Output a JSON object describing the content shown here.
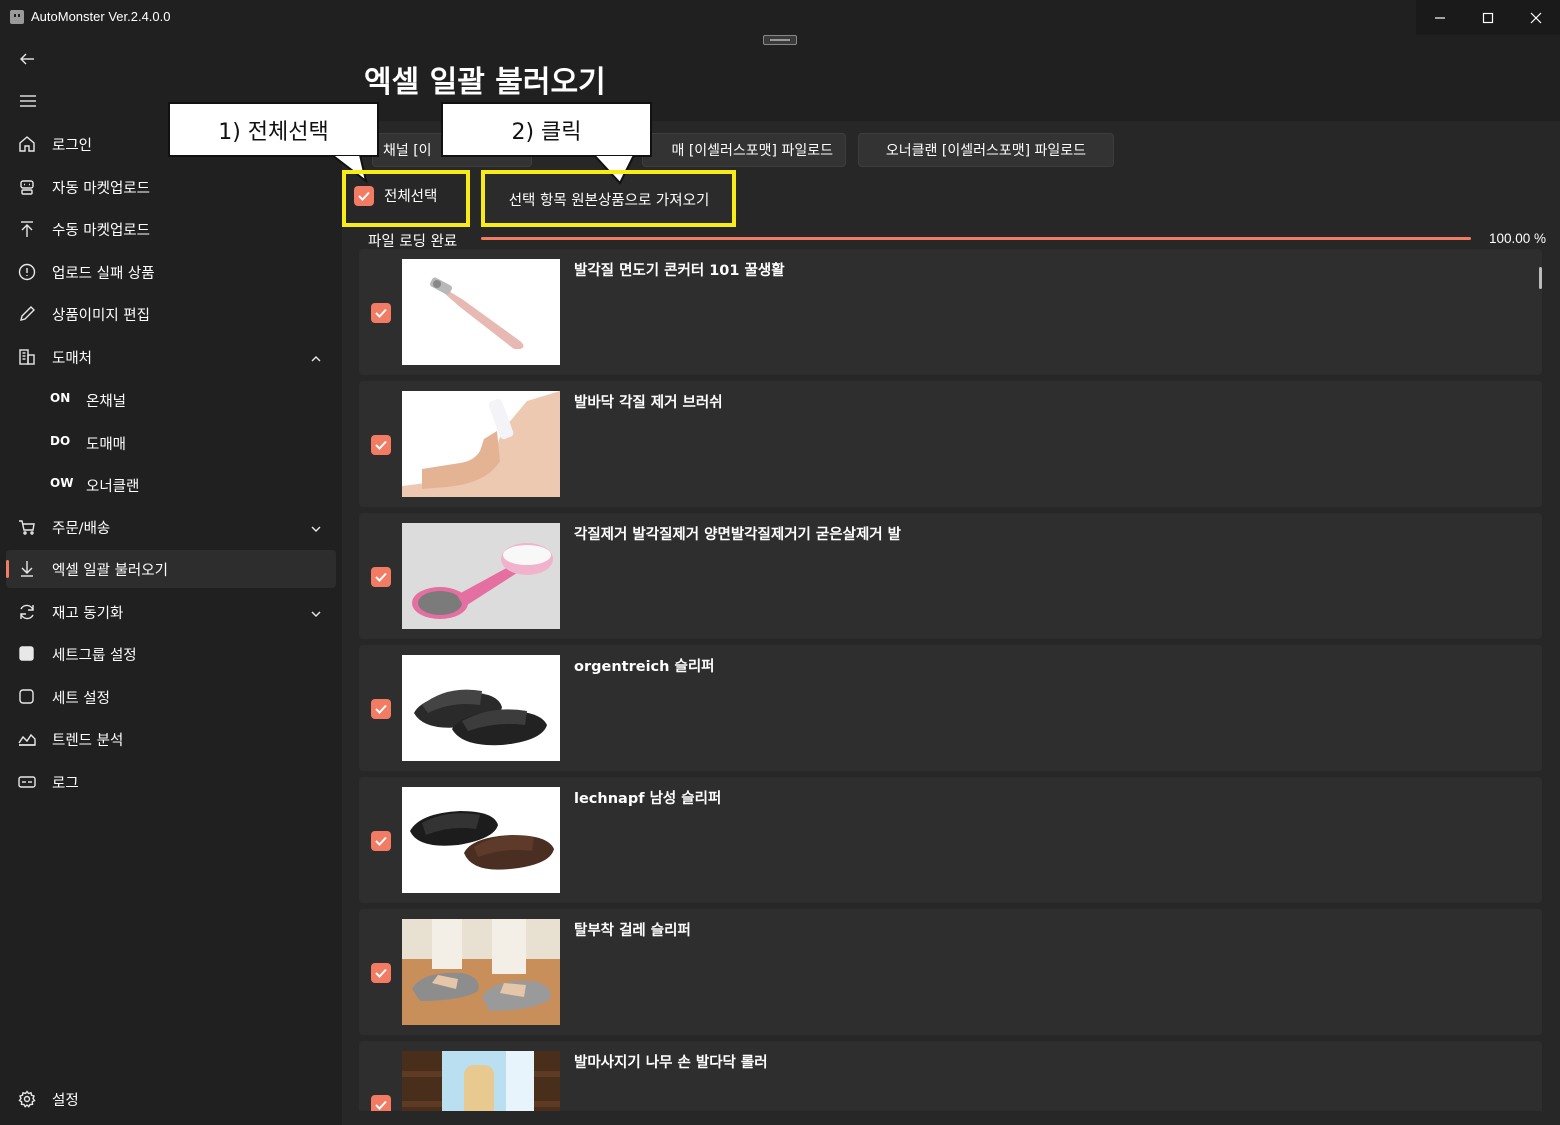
{
  "window": {
    "title": "AutoMonster Ver.2.4.0.0",
    "controls": [
      "minimize-icon",
      "maximize-icon",
      "close-icon"
    ]
  },
  "sidebar": {
    "items": [
      {
        "label": "로그인",
        "icon": "home-icon"
      },
      {
        "label": "자동 마켓업로드",
        "icon": "robot-icon"
      },
      {
        "label": "수동 마켓업로드",
        "icon": "upload-icon"
      },
      {
        "label": "업로드 실패 상품",
        "icon": "alert-circle-icon"
      },
      {
        "label": "상품이미지 편집",
        "icon": "pen-icon"
      },
      {
        "label": "도매처",
        "icon": "building-icon",
        "expanded": true
      },
      {
        "label": "주문/배송",
        "icon": "cart-icon",
        "expanded": false
      },
      {
        "label": "엑셀 일괄 불러오기",
        "icon": "download-icon",
        "active": true
      },
      {
        "label": "재고 동기화",
        "icon": "sync-icon",
        "expanded": false
      },
      {
        "label": "세트그룹 설정",
        "icon": "square-filled-icon"
      },
      {
        "label": "세트 설정",
        "icon": "square-outline-icon"
      },
      {
        "label": "트렌드 분석",
        "icon": "area-chart-icon"
      },
      {
        "label": "로그",
        "icon": "log-icon"
      }
    ],
    "sub_items": [
      {
        "code": "ON",
        "label": "온채널"
      },
      {
        "code": "DO",
        "label": "도매매"
      },
      {
        "code": "OW",
        "label": "오너클랜"
      }
    ],
    "settings": {
      "label": "설정",
      "icon": "gear-icon"
    }
  },
  "main": {
    "title": "엑셀 일괄 불러오기",
    "download_buttons": [
      "채널 [이",
      "매 [이셀러스포맷] 파일로드",
      "오너클랜 [이셀러스포맷] 파일로드"
    ],
    "select_all_label": "전체선택",
    "import_button": "선택 항목 원본상품으로 가져오기",
    "progress": {
      "label": "파일 로딩 완료",
      "value": 1.0,
      "text": "100.00 %"
    },
    "products": [
      {
        "title": "발각질 면도기 콘커터 101 꿀생활",
        "checked": true
      },
      {
        "title": "발바닥 각질 제거 브러쉬",
        "checked": true
      },
      {
        "title": "각질제거 발각질제거 양면발각질제거기 굳은살제거 발",
        "checked": true
      },
      {
        "title": "orgentreich 슬리퍼",
        "checked": true
      },
      {
        "title": "lechnapf 남성 슬리퍼",
        "checked": true
      },
      {
        "title": "탈부착 걸레 슬리퍼",
        "checked": true
      },
      {
        "title": "발마사지기 나무 손 발다닥 롤러",
        "checked": true
      }
    ]
  },
  "annotations": {
    "step1": "1) 전체선택",
    "step2": "2) 클릭"
  },
  "colors": {
    "accent": "#f27c63",
    "highlight": "#f7ec19",
    "background": "#202020",
    "panel": "#272727",
    "row": "#2e2e2e"
  }
}
